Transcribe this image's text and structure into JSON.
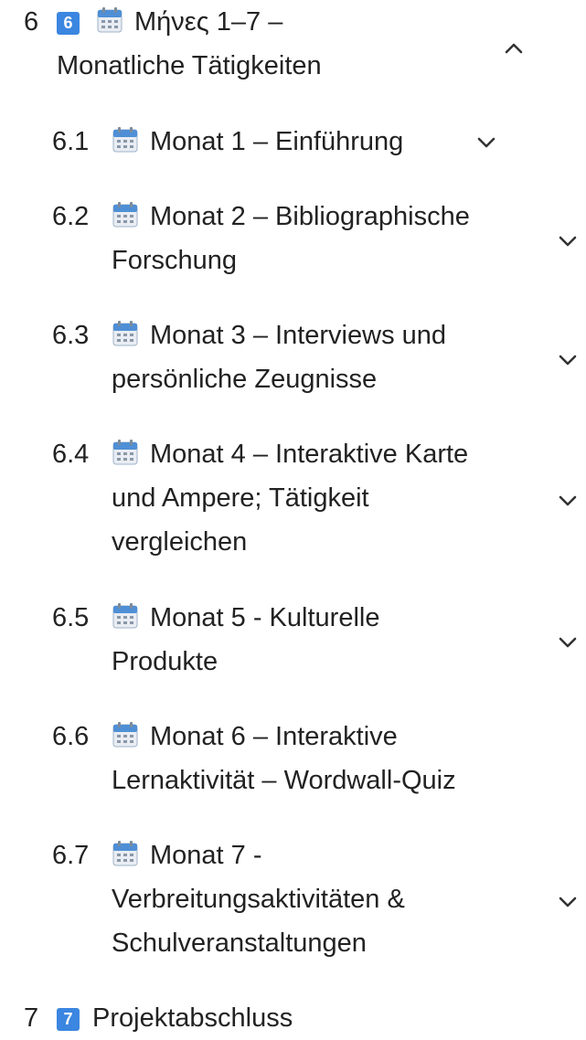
{
  "section6": {
    "number": "6",
    "badge": "6",
    "title_line1": "Μήνες 1–7 –",
    "title_line2": "Monatliche Tätigkeiten",
    "toggle_icon": "chevron-up-icon",
    "children": [
      {
        "number": "6.1",
        "line1": "Monat 1 – Einführung",
        "toggle_icon": "chevron-down-icon"
      },
      {
        "number": "6.2",
        "line1": "Monat 2 – Bibliographische",
        "line2": "Forschung",
        "toggle_icon": "chevron-down-icon"
      },
      {
        "number": "6.3",
        "line1": "Monat 3 – Interviews und",
        "line2": "persönliche Zeugnisse",
        "toggle_icon": "chevron-down-icon"
      },
      {
        "number": "6.4",
        "line1": "Monat 4 – Interaktive Karte",
        "line2": "und Ampere; Tätigkeit",
        "line3": "vergleichen",
        "toggle_icon": "chevron-down-icon"
      },
      {
        "number": "6.5",
        "line1": "Monat 5 - Kulturelle",
        "line2": "Produkte",
        "toggle_icon": "chevron-down-icon"
      },
      {
        "number": "6.6",
        "line1": "Monat 6 – Interaktive",
        "line2": "Lernaktivität – Wordwall-Quiz"
      },
      {
        "number": "6.7",
        "line1": "Monat 7 -",
        "line2": "Verbreitungsaktivitäten &",
        "line3": "Schulveranstaltungen",
        "toggle_icon": "chevron-down-icon"
      }
    ]
  },
  "section7": {
    "number": "7",
    "badge": "7",
    "title": "Projektabschluss"
  },
  "colors": {
    "text": "#222222",
    "badge": "#3b86e0",
    "calendar_top": "#4f8fd6",
    "calendar_body": "#e9edf3",
    "chevron": "#333333"
  },
  "icons": {
    "calendar": "calendar-icon",
    "badge": "keycap-number-icon"
  }
}
